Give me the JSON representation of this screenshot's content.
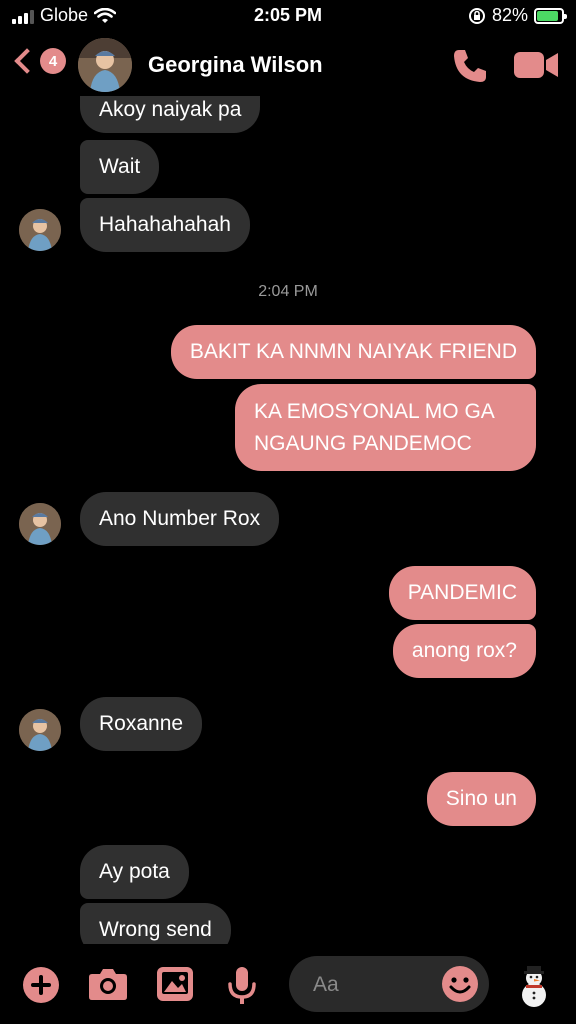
{
  "status_bar": {
    "carrier": "Globe",
    "time": "2:05 PM",
    "battery": "82%",
    "battery_level": 0.82
  },
  "header": {
    "back_badge": "4",
    "contact_name": "Georgina Wilson"
  },
  "messages": {
    "m1": "Akoy naiyak pa",
    "m2": "Wait",
    "m3": "Hahahahahah",
    "timestamp": "2:04 PM",
    "m4": "BAKIT KA NNMN NAIYAK FRIEND",
    "m5_line1": "KA EMOSYONAL MO GA",
    "m5_line2": "NGAUNG PANDEMOC",
    "m6": "Ano Number Rox",
    "m7": "PANDEMIC",
    "m8": "anong rox?",
    "m9": "Roxanne",
    "m10": "Sino un",
    "m11": "Ay pota",
    "m12": "Wrong send"
  },
  "composer": {
    "placeholder": "Aa"
  },
  "icons": [
    "back-chevron-icon",
    "phone-icon",
    "video-camera-icon",
    "plus-icon",
    "camera-icon",
    "photo-icon",
    "microphone-icon",
    "smiley-icon",
    "snowman-sticker-icon"
  ],
  "colors": {
    "accent": "#e38b8b",
    "incoming_bubble": "#303030",
    "background": "#000000"
  }
}
